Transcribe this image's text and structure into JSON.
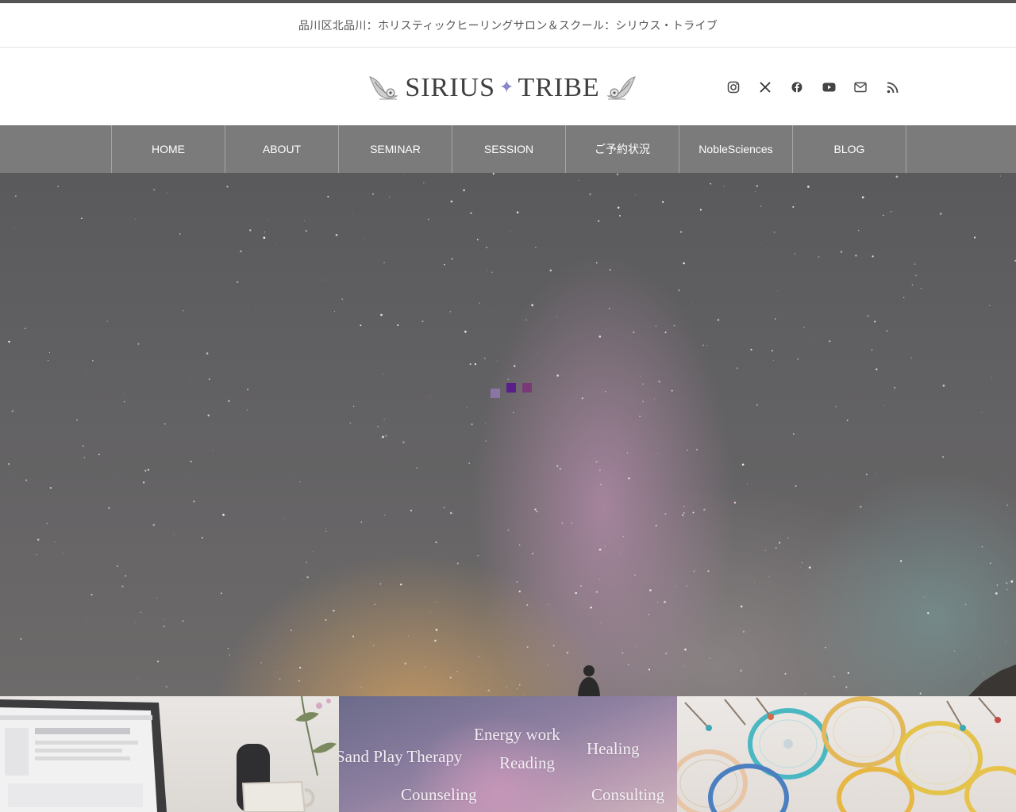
{
  "site": {
    "tagline": "品川区北品川：ホリスティックヒーリングサロン＆スクール：シリウス・トライブ",
    "logo": {
      "word1": "SIRIUS",
      "word2": "TRIBE",
      "star": "✦"
    }
  },
  "social": [
    {
      "name": "instagram-icon"
    },
    {
      "name": "x-icon"
    },
    {
      "name": "facebook-icon"
    },
    {
      "name": "youtube-icon"
    },
    {
      "name": "mail-icon"
    },
    {
      "name": "rss-icon"
    }
  ],
  "nav": {
    "items": [
      {
        "label": "HOME"
      },
      {
        "label": "ABOUT"
      },
      {
        "label": "SEMINAR"
      },
      {
        "label": "SESSION"
      },
      {
        "label": "ご予約状況"
      },
      {
        "label": "NobleSciences"
      },
      {
        "label": "BLOG"
      }
    ]
  },
  "colors": {
    "nav_bg": "#7b7b7b",
    "loader": [
      "#8a76a6",
      "#5a1f8a",
      "#7a3a78"
    ]
  },
  "panels": {
    "services": {
      "words": [
        "Energy work",
        "Sand Play Therapy",
        "Healing",
        "Reading",
        "Counseling",
        "Consulting"
      ]
    }
  }
}
